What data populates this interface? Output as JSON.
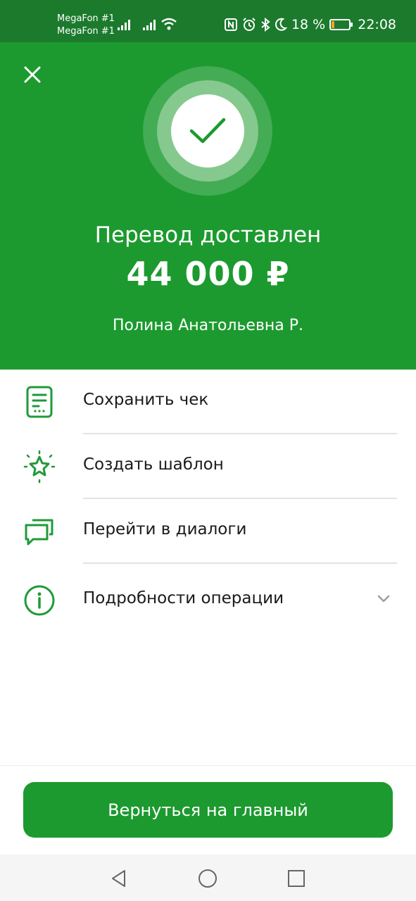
{
  "status_bar": {
    "carrier_1": "MegaFon #1",
    "carrier_2": "MegaFon #1",
    "battery_percent": "18 %",
    "battery_level": 0.18,
    "time": "22:08",
    "icons": [
      "signal-icon",
      "signal-icon",
      "wifi-icon",
      "nfc-icon",
      "alarm-icon",
      "bluetooth-icon",
      "moon-icon",
      "battery-icon"
    ]
  },
  "hero": {
    "close_icon": "close-icon",
    "success_icon": "checkmark-icon",
    "title": "Перевод доставлен",
    "amount": "44 000 ₽",
    "recipient": "Полина Анатольевна Р."
  },
  "actions": [
    {
      "label": "Сохранить чек",
      "icon": "receipt-icon"
    },
    {
      "label": "Создать шаблон",
      "icon": "star-icon"
    },
    {
      "label": "Перейти в диалоги",
      "icon": "chat-icon"
    },
    {
      "label": "Подробности операции",
      "icon": "info-icon",
      "expand_icon": "chevron-down-icon"
    }
  ],
  "footer": {
    "primary_button": "Вернуться на главный"
  },
  "navbar": {
    "icons": [
      "back-icon",
      "home-icon",
      "recents-icon"
    ]
  },
  "colors": {
    "brand_green": "#1c9a2f",
    "status_bar_green": "#1c7a2d",
    "icon_green": "#1f9a3a",
    "battery_warning": "#f5a623"
  }
}
